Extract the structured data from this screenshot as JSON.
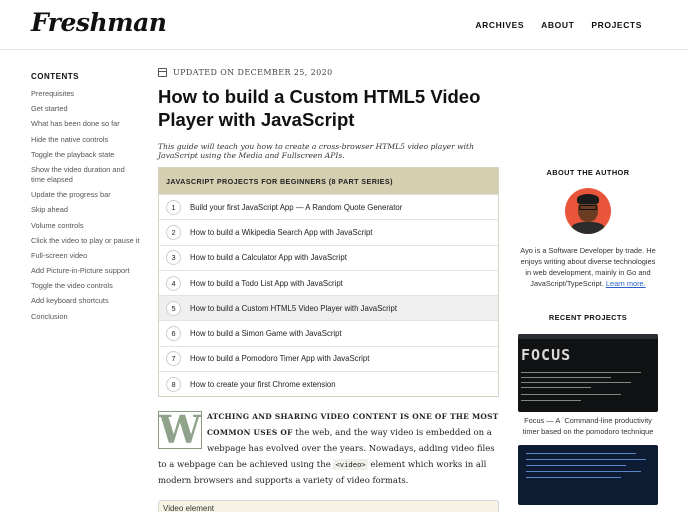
{
  "header": {
    "logo": "Freshman",
    "nav": [
      "ARCHIVES",
      "ABOUT",
      "PROJECTS"
    ]
  },
  "toc": {
    "title": "CONTENTS",
    "items": [
      "Prerequisites",
      "Get started",
      "What has been done so far",
      "Hide the native controls",
      "Toggle the playback state",
      "Show the video duration and time elapsed",
      "Update the progress bar",
      "Skip ahead",
      "Volume controls",
      "Click the video to play or pause it",
      "Full-screen video",
      "Add Picture-in-Picture support",
      "Toggle the video controls",
      "Add keyboard shortcuts",
      "Conclusion"
    ]
  },
  "post": {
    "date": "UPDATED ON DECEMBER 25, 2020",
    "title": "How to build a Custom HTML5 Video Player with JavaScript",
    "subtitle": "This guide will teach you how to create a cross-browser HTML5 video player with JavaScript using the Media and Fullscreen APIs."
  },
  "series": {
    "heading": "JAVASCRIPT PROJECTS FOR BEGINNERS (8 PART SERIES)",
    "active_index": 4,
    "items": [
      {
        "num": "1",
        "label": "Build your first JavaScript App — A Random Quote Generator"
      },
      {
        "num": "2",
        "label": "How to build a Wikipedia Search App with JavaScript"
      },
      {
        "num": "3",
        "label": "How to build a Calculator App with JavaScript"
      },
      {
        "num": "4",
        "label": "How to build a Todo List App with JavaScript"
      },
      {
        "num": "5",
        "label": "How to build a Custom HTML5 Video Player with JavaScript"
      },
      {
        "num": "6",
        "label": "How to build a Simon Game with JavaScript"
      },
      {
        "num": "7",
        "label": "How to build a Pomodoro Timer App with JavaScript"
      },
      {
        "num": "8",
        "label": "How to create your first Chrome extension"
      }
    ]
  },
  "intro": {
    "dropcap": "W",
    "lead": "ATCHING AND SHARING VIDEO CONTENT IS ONE OF THE MOST COMMON USES OF",
    "text1": " the web, and the way video is embedded on a webpage has evolved over the years. Nowadays, adding video files to a webpage can be achieved using the ",
    "code": "<video>",
    "text2": " element which works in all modern browsers and supports a variety of video formats."
  },
  "video_box": {
    "label": "Video element"
  },
  "aside": {
    "about_heading": "ABOUT THE AUTHOR",
    "bio": "Ayo is a Software Developer by trade. He enjoys writing about diverse technologies in web development, mainly in Go and JavaScript/TypeScript.",
    "learn_more": "Learn more.",
    "projects_heading": "RECENT PROJECTS",
    "project1_image_text": "FOCUS",
    "project1_caption": "Focus — A `Command-line productivity timer based on the pomodoro technique"
  },
  "colors": {
    "series_header_bg": "#d4cfb0",
    "dropcap": "#8ea389",
    "link": "#2962c4",
    "avatar_bg": "#e8553a"
  }
}
